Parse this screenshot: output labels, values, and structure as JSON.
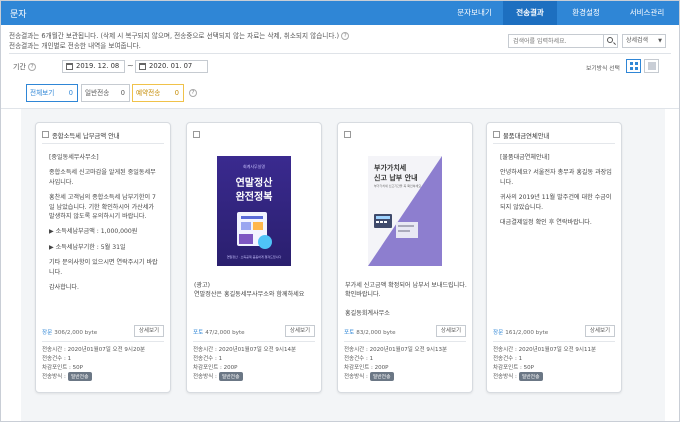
{
  "header": {
    "app_title": "문자",
    "tabs": [
      {
        "label": "문자보내기",
        "active": false
      },
      {
        "label": "전송결과",
        "active": true
      },
      {
        "label": "환경설정",
        "active": false
      },
      {
        "label": "서비스관리",
        "active": false
      }
    ]
  },
  "description": {
    "line1": "전송결과는 6개월간 보관됩니다. (삭제 시 복구되지 않으며, 전송중으로 선택되지 않는 자료는 삭제, 취소되지 않습니다.)",
    "line2": "전송결과는 개인별로 전송한 내역을 보여줍니다."
  },
  "search": {
    "placeholder": "검색어를 입력하세요.",
    "select_value": "상세검색"
  },
  "filter": {
    "period_label": "기간",
    "start_date": "2019. 12. 08",
    "end_date": "2020. 01. 07",
    "tilde": "~",
    "view_mode_label": "보기방식 선택",
    "tabs": [
      {
        "label": "전체보기",
        "count": "0"
      },
      {
        "label": "일반전송",
        "count": "0"
      },
      {
        "label": "예약전송",
        "count": "0"
      }
    ]
  },
  "cards": [
    {
      "title": "종합소득세 납부금액 안내",
      "body": [
        "[중일동세무사무소]",
        "종합소득세 신고마감을 알게된 중일동세무사입니다.",
        "홍찬세 고객님의 종합소득세 납부기한이 7일 남았습니다. 기한 확인하시어 가산세가 발생하지 않도록 유의하시기 바랍니다.",
        "▶ 소득세납부금액 : 1,000,000원",
        "▶ 소득세납부기한 : 5월 31일",
        "기타 문의사항이 있으시면 연락주시기 바랍니다.",
        "감사합니다."
      ],
      "bytes_type": "장문",
      "bytes": "306/2,000 byte",
      "detail_label": "상세보기",
      "sent_time": "전송시간 : 2020년01월07일 오전 9시20분",
      "count": "전송건수 : 1",
      "points": "차감포인트 : 50P",
      "method_label": "전송방식 :",
      "method": "일반전송"
    },
    {
      "title": "",
      "poster": {
        "small": "회계사무실명",
        "title1": "연말정산",
        "title2": "완전정복",
        "foot": "연말정산 · 소득공제 꼼꼼하게 챙겨드립니다"
      },
      "caption": "(광고)\n연말정산은 홍길동세무사무소와 함께하세요",
      "bytes_type": "포토",
      "bytes": "47/2,000 byte",
      "detail_label": "상세보기",
      "sent_time": "전송시간 : 2020년01월07일 오전 9시14분",
      "count": "전송건수 : 1",
      "points": "차감포인트 : 200P",
      "method_label": "전송방식 :",
      "method": "일반전송"
    },
    {
      "title": "",
      "poster": {
        "title1": "부가가치세",
        "title2": "신고 납부 안내",
        "small": "부가가치세 신고기간을 꼭 확인하세요"
      },
      "caption": "부가세 신고금액 확정되어 납부서 보내드립니다. 확인바랍니다.\n\n홍길동회계사무소",
      "bytes_type": "포토",
      "bytes": "83/2,000 byte",
      "detail_label": "상세보기",
      "sent_time": "전송시간 : 2020년01월07일 오전 9시13분",
      "count": "전송건수 : 1",
      "points": "차감포인트 : 200P",
      "method_label": "전송방식 :",
      "method": "일반전송"
    },
    {
      "title": "물품대금연체안내",
      "body": [
        "[물품대금연체안내]",
        "안녕하세요? 서울전자 총무과 홍길동 과장입니다.",
        "귀사의 2019년 11월 발주건에 대한 수금이 되지 않았습니다.",
        "대금결제일정 확인 후 연락바랍니다."
      ],
      "bytes_type": "장문",
      "bytes": "161/2,000 byte",
      "detail_label": "상세보기",
      "sent_time": "전송시간 : 2020년01월07일 오전 9시11분",
      "count": "전송건수 : 1",
      "points": "차감포인트 : 50P",
      "method_label": "전송방식 :",
      "method": "일반전송"
    }
  ]
}
